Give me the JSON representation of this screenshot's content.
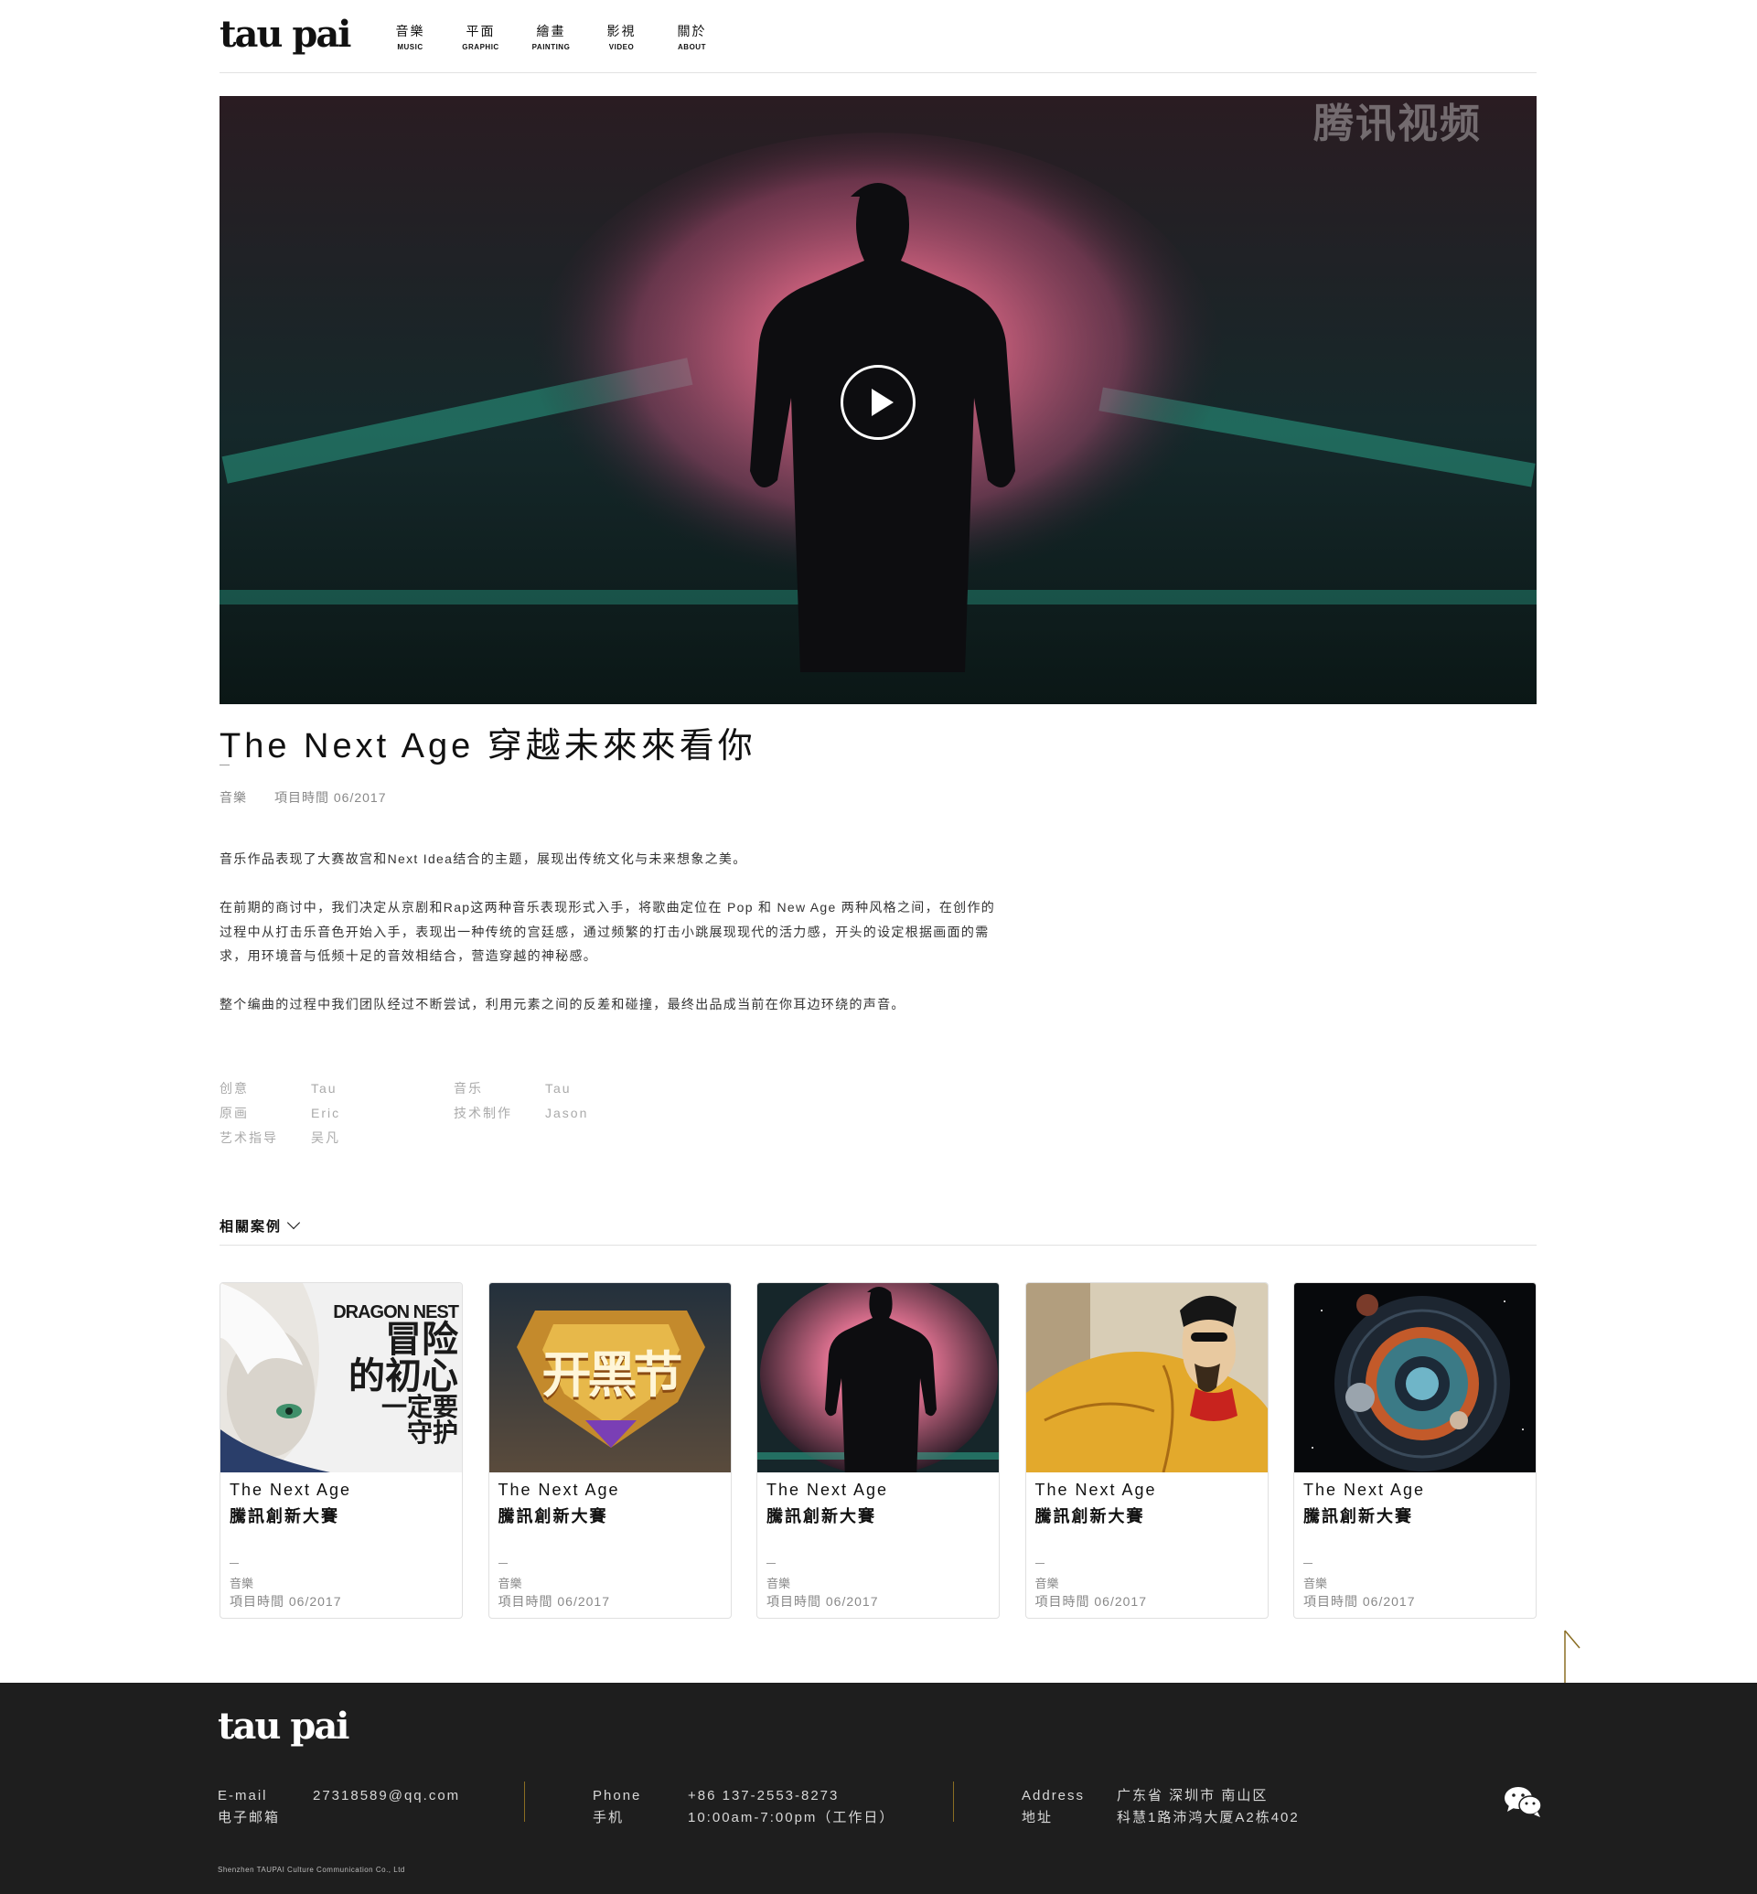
{
  "brand": {
    "logo_text": "tau pai"
  },
  "nav": [
    {
      "zh": "音樂",
      "en": "MUSIC"
    },
    {
      "zh": "平面",
      "en": "GRAPHIC"
    },
    {
      "zh": "繪畫",
      "en": "PAINTING"
    },
    {
      "zh": "影視",
      "en": "VIDEO"
    },
    {
      "zh": "關於",
      "en": "ABOUT"
    }
  ],
  "video": {
    "watermark": "腾讯视频",
    "play_icon": "play-icon"
  },
  "project": {
    "title": "The Next Age 穿越未來來看你",
    "category": "音樂",
    "date_label": "項目時間 06/2017",
    "paragraphs": [
      "音乐作品表现了大赛故宫和Next Idea结合的主题，展现出传统文化与未来想象之美。",
      "在前期的商讨中，我们决定从京剧和Rap这两种音乐表现形式入手，将歌曲定位在 Pop 和 New Age 两种风格之间，在创作的过程中从打击乐音色开始入手，表现出一种传统的宫廷感，通过频繁的打击小跳展现现代的活力感，开头的设定根据画面的需求，用环境音与低频十足的音效相结合，营造穿越的神秘感。",
      "整个编曲的过程中我们团队经过不断尝试，利用元素之间的反差和碰撞，最终出品成当前在你耳边环绕的声音。"
    ],
    "credits": [
      {
        "k": "创意",
        "v": "Tau"
      },
      {
        "k": "原画",
        "v": "Eric"
      },
      {
        "k": "艺术指导",
        "v": "吴凡"
      },
      {
        "k": "音乐",
        "v": "Tau"
      },
      {
        "k": "技术制作",
        "v": "Jason"
      }
    ]
  },
  "related": {
    "heading": "相關案例",
    "cards": [
      {
        "t1": "The Next Age",
        "t2": "騰訊創新大賽",
        "cat": "音樂",
        "date": "項目時間 06/2017",
        "img_text": [
          "DRAGON NEST",
          "冒险",
          "的初心",
          "一定要",
          "守护"
        ]
      },
      {
        "t1": "The Next Age",
        "t2": "騰訊創新大賽",
        "cat": "音樂",
        "date": "項目時間 06/2017",
        "img_text": [
          "开黑节"
        ]
      },
      {
        "t1": "The Next Age",
        "t2": "騰訊創新大賽",
        "cat": "音樂",
        "date": "項目時間 06/2017",
        "img_text": []
      },
      {
        "t1": "The Next Age",
        "t2": "騰訊創新大賽",
        "cat": "音樂",
        "date": "項目時間 06/2017",
        "img_text": []
      },
      {
        "t1": "The Next Age",
        "t2": "騰訊創新大賽",
        "cat": "音樂",
        "date": "項目時間 06/2017",
        "img_text": []
      }
    ]
  },
  "footer": {
    "logo_text": "tau pai",
    "email": {
      "k1": "E-mail",
      "k2": "电子邮箱",
      "v": "27318589@qq.com"
    },
    "phone": {
      "k1": "Phone",
      "k2": "手机",
      "v1": "+86 137-2553-8273",
      "v2": "10:00am-7:00pm（工作日）"
    },
    "address": {
      "k1": "Address",
      "k2": "地址",
      "v1": "广东省 深圳市 南山区",
      "v2": "科慧1路沛鸿大厦A2栋402"
    },
    "copyright": "Shenzhen TAUPAI Culture Communication Co., Ltd"
  },
  "colors": {
    "accent_gold": "#8a6d22",
    "footer_bg": "#1e1e1e"
  }
}
